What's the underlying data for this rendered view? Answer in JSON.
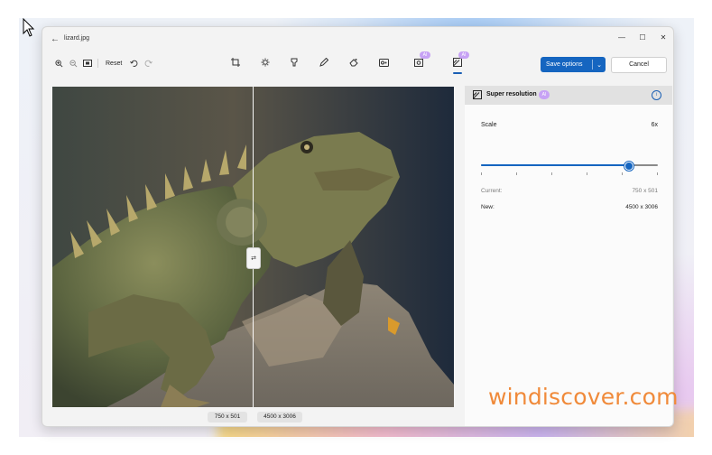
{
  "window": {
    "title": "lizard.jpg"
  },
  "toolbar": {
    "reset_label": "Reset",
    "tools": [
      "crop-icon",
      "adjust-icon",
      "filter-icon",
      "markup-icon",
      "erase-icon",
      "background-blur-icon",
      "generative-erase-icon",
      "super-resolution-icon"
    ],
    "ai_badge": "AI"
  },
  "actions": {
    "save_label": "Save options",
    "cancel_label": "Cancel"
  },
  "canvas": {
    "left_size": "750 x 501",
    "right_size": "4500 x 3006"
  },
  "panel": {
    "title": "Super resolution",
    "ai_badge": "AI",
    "scale_label": "Scale",
    "scale_value": "6x",
    "scale_fraction": 0.83,
    "current_label": "Current:",
    "current_value": "750 x 501",
    "new_label": "New:",
    "new_value": "4500 x 3006"
  },
  "watermark": "windiscover.com",
  "colors": {
    "accent": "#1565c0",
    "ai_badge": "#c7a2f5",
    "watermark": "#f08a3a"
  }
}
